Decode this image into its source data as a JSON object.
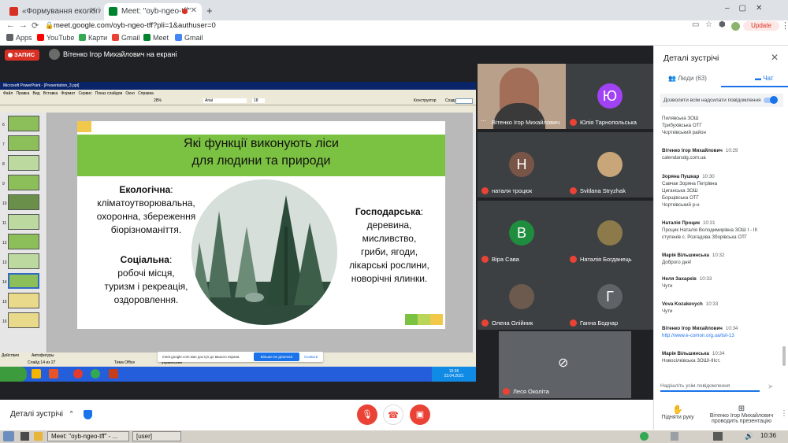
{
  "browser": {
    "tabs": [
      {
        "label": "«Формування екологічн",
        "favicon_color": "#d93025"
      },
      {
        "label": "Meet: \"oyb-ngeo-tff\"",
        "favicon_color": "#00832d"
      }
    ],
    "new_tab": "+",
    "url": "meet.google.com/oyb-ngeo-tff?pli=1&authuser=0",
    "update_label": "Update",
    "bookmarks": [
      "Apps",
      "YouTube",
      "Карти",
      "Gmail",
      "Meet",
      "Gmail"
    ]
  },
  "meet": {
    "recording_label": "ЗАПИС",
    "presenter_label": "Вітенко Ігор Михайлович на екрані",
    "ppt": {
      "title": "Microsoft PowerPoint - [Presentation_3.ppt]",
      "menu": [
        "Файл",
        "Правка",
        "Вид",
        "Вставка",
        "Формат",
        "Сервис",
        "Показ слайдов",
        "Окно",
        "Справка"
      ],
      "zoom": "28%",
      "font": "Arial",
      "size": "18",
      "constructor": "Конструктор",
      "new_slide": "Создать слайд",
      "status_slide": "Слайд 14 из 27",
      "status_theme": "Тема Office",
      "status_lang": "украинский",
      "actions": "Действия",
      "autoshapes": "Автофигуры",
      "thumb_numbers": [
        "6",
        "7",
        "8",
        "9",
        "10",
        "11",
        "12",
        "13",
        "14",
        "15",
        "16"
      ]
    },
    "slide": {
      "title_line1": "Які функції виконують ліси",
      "title_line2": "для людини та природи",
      "eco_head": "Екологічна",
      "eco_text": [
        ":",
        "кліматоутворювальна,",
        "охоронна, збереження",
        "біорізноманіття."
      ],
      "soc_head": "Соціальна",
      "soc_text": [
        ":",
        "робочі місця,",
        "туризм і рекреація,",
        "оздоровлення."
      ],
      "econ_head": "Господарська",
      "econ_text": [
        ":",
        "деревина,",
        "мисливство,",
        "гриби, ягоди,",
        "лікарські рослини,",
        "новорічні ялинки."
      ]
    },
    "share_notice": {
      "text": "meet.google.com має доступ до вашого екрана.",
      "stop": "Більше не ділитися",
      "hide": "Сховати"
    },
    "xp_clock": {
      "time": "10:36",
      "date": "23.04.2021"
    },
    "tiles": [
      {
        "name": "Вітенко Ігор Михайлович",
        "initial": "",
        "color": "#8a6a5a"
      },
      {
        "name": "Юлія Тарнопольська",
        "initial": "Ю",
        "color": "#a142f4"
      },
      {
        "name": "наталя троцюк",
        "initial": "Н",
        "color": "#795548"
      },
      {
        "name": "Svitlana Stryzhak",
        "initial": "",
        "color": "#c9a57a"
      },
      {
        "name": "Віра Сава",
        "initial": "В",
        "color": "#1e8e3e"
      },
      {
        "name": "Наталія Богданець",
        "initial": "",
        "color": "#8d7a4a"
      },
      {
        "name": "Олена Олійник",
        "initial": "",
        "color": "#6d5a4e"
      },
      {
        "name": "Ганна Боднар",
        "initial": "Г",
        "color": "#5f6368"
      },
      {
        "name": "Леся Околіта",
        "initial": "",
        "color": "#5f6368"
      }
    ],
    "bottom": {
      "details": "Деталі зустрічі",
      "raise_hand": "Підняти руку",
      "presenting": [
        "Вітенко Ігор Михайлович",
        "проводить презентацію"
      ]
    }
  },
  "panel": {
    "title": "Деталі зустрічі",
    "tab_people": "Люди (63)",
    "tab_chat": "Чат",
    "allow_label": "Дозволити всім надсилати повідомлення",
    "messages": [
      {
        "sender": "",
        "time": "",
        "lines": [
          "Пилявська ЗОШ",
          "Трибухівська ОТГ",
          "Чортківський район"
        ]
      },
      {
        "sender": "Вітенко Ігор Михайлович",
        "time": "10:29",
        "lines": [
          "calendarsdg.com.ua"
        ]
      },
      {
        "sender": "Зоряна Пушкар",
        "time": "10:30",
        "lines": [
          "Савчак Зоряна Петрівна",
          "Циганська ЗОШ",
          "Борщівська ОТГ",
          "Чортківський р-н"
        ]
      },
      {
        "sender": "Наталія Процик",
        "time": "10:31",
        "lines": [
          "Процик Наталія Володимирівна ЗОШ I - III",
          "ступенів с. Розгадова Зборівська ОТГ"
        ]
      },
      {
        "sender": "Марія Вільшинська",
        "time": "10:32",
        "lines": [
          "Доброго дня!"
        ]
      },
      {
        "sender": "Неля Захарків",
        "time": "10:33",
        "lines": [
          "Чути"
        ]
      },
      {
        "sender": "Vova Kozakevych",
        "time": "10:33",
        "lines": [
          "Чути"
        ]
      },
      {
        "sender": "Вітенко Ігор Михайлович",
        "time": "10:34",
        "lines": [
          "http://www.e-comon.org.ua/tsil-13"
        ]
      },
      {
        "sender": "Марія Вільшинська",
        "time": "10:34",
        "lines": [
          "Новосілківська ЗОШІ-ІІІст."
        ]
      }
    ],
    "input_placeholder": "Надішліть усім повідомлення"
  },
  "os": {
    "tasks": [
      "Meet: \"oyb-ngeo-tff\" - ...",
      "[user]"
    ],
    "clock": "10:36"
  }
}
